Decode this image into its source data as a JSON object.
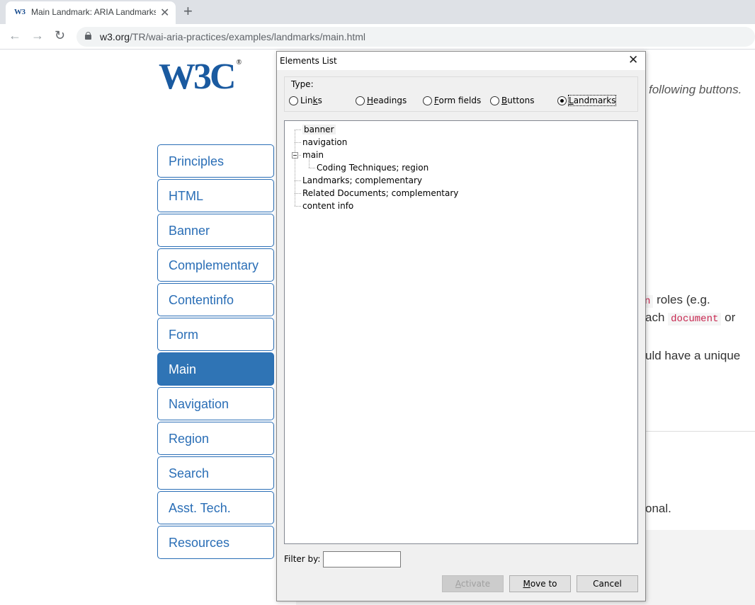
{
  "browser": {
    "favicon_text": "W3",
    "tab_title": "Main Landmark: ARIA Landmarks",
    "url_host": "w3.org",
    "url_path": "/TR/wai-aria-practices/examples/landmarks/main.html"
  },
  "page": {
    "logo_text": "W3C",
    "logo_mark": "®",
    "nav_items": [
      "Principles",
      "HTML",
      "Banner",
      "Complementary",
      "Contentinfo",
      "Form",
      "Main",
      "Navigation",
      "Region",
      "Search",
      "Asst. Tech.",
      "Resources"
    ],
    "active_nav": "Main",
    "fragments": {
      "following_buttons": "following buttons.",
      "roles_eg": "roles (e.g.",
      "code_n": "n",
      "each": "ach",
      "code_document": "document",
      "or": "or",
      "unique": "uld have a unique",
      "onal": "onal."
    }
  },
  "dialog": {
    "title": "Elements List",
    "type_label": "Type:",
    "radios": [
      {
        "label": "Links",
        "key": "k",
        "checked": false
      },
      {
        "label": "Headings",
        "key": "H",
        "checked": false
      },
      {
        "label": "Form fields",
        "key": "F",
        "checked": false
      },
      {
        "label": "Buttons",
        "key": "B",
        "checked": false
      },
      {
        "label": "Landmarks",
        "key": "L",
        "checked": true
      }
    ],
    "tree": [
      {
        "label": "banner",
        "level": 0,
        "selected": true
      },
      {
        "label": "navigation",
        "level": 0
      },
      {
        "label": "main",
        "level": 0,
        "expanded": true
      },
      {
        "label": "Coding Techniques; region",
        "level": 1
      },
      {
        "label": "Landmarks; complementary",
        "level": 0
      },
      {
        "label": "Related Documents; complementary",
        "level": 0
      },
      {
        "label": "content info",
        "level": 0
      }
    ],
    "filter_label": "Filter by:",
    "filter_value": "",
    "buttons": {
      "activate": "Activate",
      "move_to": "Move to",
      "cancel": "Cancel"
    }
  }
}
